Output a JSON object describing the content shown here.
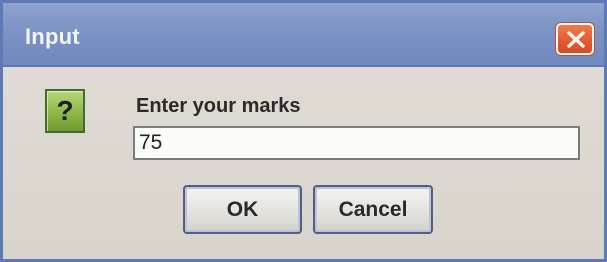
{
  "dialog": {
    "title": "Input",
    "close_icon": "close-x-icon",
    "message_icon": "question-icon",
    "message_icon_glyph": "?",
    "prompt": "Enter your marks",
    "input_value": "75",
    "ok_label": "OK",
    "cancel_label": "Cancel"
  },
  "colors": {
    "titlebar": "#7b92c4",
    "close_button": "#e85b2e",
    "question_icon": "#8ab542",
    "background": "#d9d6cf"
  }
}
